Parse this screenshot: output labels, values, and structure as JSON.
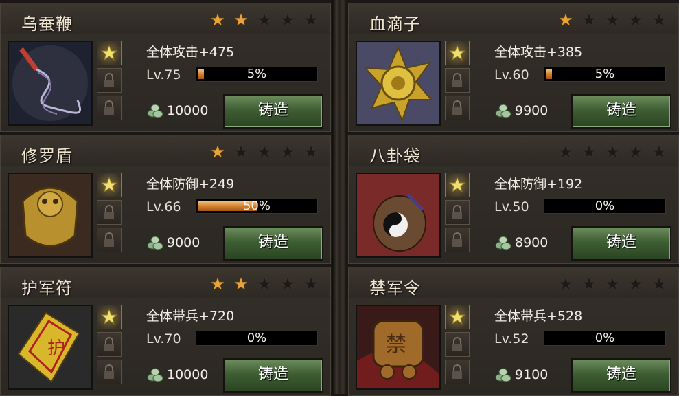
{
  "forge_button_label": "铸造",
  "cards": [
    {
      "name": "乌蚕鞭",
      "stars": 2,
      "stat": "全体攻击+475",
      "level": "Lv.75",
      "progress_pct": 5,
      "progress_label": "5%",
      "cost": "10000",
      "image": "whip-icon"
    },
    {
      "name": "血滴子",
      "stars": 1,
      "stat": "全体攻击+385",
      "level": "Lv.60",
      "progress_pct": 5,
      "progress_label": "5%",
      "cost": "9900",
      "image": "star-disc-icon"
    },
    {
      "name": "修罗盾",
      "stars": 1,
      "stat": "全体防御+249",
      "level": "Lv.66",
      "progress_pct": 50,
      "progress_label": "50%",
      "cost": "9000",
      "image": "shield-icon"
    },
    {
      "name": "八卦袋",
      "stars": 0,
      "stat": "全体防御+192",
      "level": "Lv.50",
      "progress_pct": 0,
      "progress_label": "0%",
      "cost": "8900",
      "image": "yinyang-bag-icon"
    },
    {
      "name": "护军符",
      "stars": 2,
      "stat": "全体带兵+720",
      "level": "Lv.70",
      "progress_pct": 0,
      "progress_label": "0%",
      "cost": "10000",
      "image": "talisman-icon"
    },
    {
      "name": "禁军令",
      "stars": 0,
      "stat": "全体带兵+528",
      "level": "Lv.52",
      "progress_pct": 0,
      "progress_label": "0%",
      "cost": "9100",
      "image": "token-icon"
    }
  ],
  "colors": {
    "star_on": "#e8a33a",
    "bar_fill": "#d07a28",
    "button": "#3e5e34"
  }
}
